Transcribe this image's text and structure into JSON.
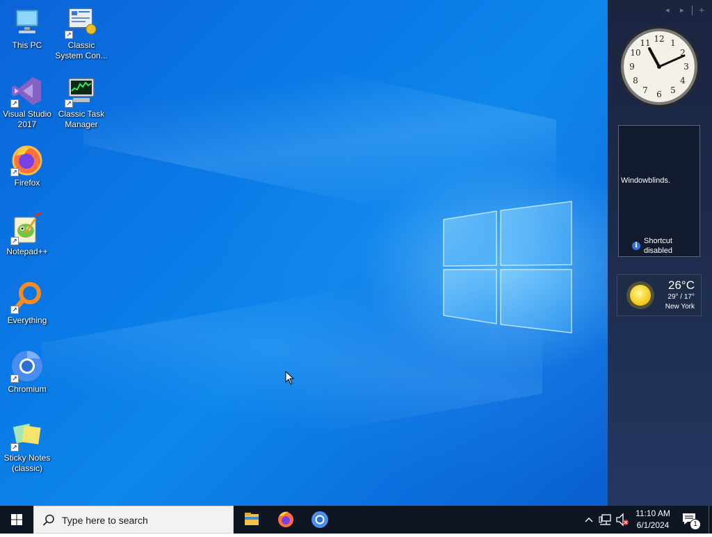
{
  "desktop": {
    "icons": [
      {
        "label": "This PC",
        "icon": "computer-icon"
      },
      {
        "label": "Classic System Con...",
        "icon": "control-panel-icon"
      },
      {
        "label": "Visual Studio 2017",
        "icon": "visual-studio-icon"
      },
      {
        "label": "Classic Task Manager",
        "icon": "task-manager-icon"
      },
      {
        "label": "Firefox",
        "icon": "firefox-icon"
      },
      {
        "label": "Notepad++",
        "icon": "notepadpp-icon"
      },
      {
        "label": "Everything",
        "icon": "everything-search-icon"
      },
      {
        "label": "Chromium",
        "icon": "chromium-icon"
      },
      {
        "label": "Sticky Notes (classic)",
        "icon": "sticky-notes-icon"
      }
    ]
  },
  "sidebar": {
    "controls": [
      "◂",
      "▸",
      "+"
    ],
    "clock_gadget": {
      "numerals": [
        "12",
        "1",
        "2",
        "3",
        "4",
        "5",
        "6",
        "7",
        "8",
        "9",
        "10",
        "11"
      ]
    },
    "windowblinds_gadget": {
      "title": "Windowblinds.",
      "note_line1": "Shortcut",
      "note_line2": "disabled"
    },
    "weather_gadget": {
      "temperature": "26°C",
      "range": "29° / 17°",
      "city": "New York"
    }
  },
  "taskbar": {
    "search_placeholder": "Type here to search",
    "pinned": [
      "file-explorer-icon",
      "firefox-icon",
      "chromium-icon"
    ],
    "time": "11:10 AM",
    "date": "6/1/2024",
    "notification_count": "1"
  },
  "colors": {
    "desktop_blue": "#0a7ae6",
    "sidebar_bg": "#1c2a4a",
    "taskbar_bg": "#0f1623"
  }
}
